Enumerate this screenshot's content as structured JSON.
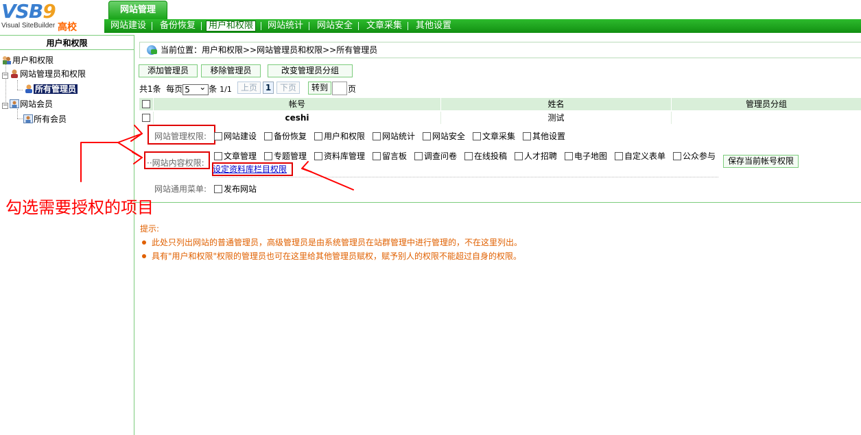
{
  "logo": {
    "text": "VSB",
    "suffix": "9",
    "subtitle": "Visual SiteBuilder",
    "badge": "高校"
  },
  "top_tab": "网站管理",
  "nav": [
    "网站建设",
    "备份恢复",
    "用户和权限",
    "网站统计",
    "网站安全",
    "文章采集",
    "其他设置"
  ],
  "left": {
    "title": "用户和权限",
    "tree": {
      "root": "用户和权限",
      "admins": "网站管理员和权限",
      "all_admins": "所有管理员",
      "members": "网站会员",
      "all_members": "所有会员"
    }
  },
  "breadcrumb": "当前位置：用户和权限>>网站管理员和权限>>所有管理员",
  "buttons": {
    "add": "添加管理员",
    "remove": "移除管理员",
    "change_group": "改变管理员分组",
    "save": "保存当前帐号权限"
  },
  "pager": {
    "total": "共1条",
    "per_page_label": "每页",
    "per_page": "5",
    "per_page_unit": "条",
    "page": "1/1",
    "prev": "上页",
    "current": "1",
    "next": "下页",
    "goto": "转到",
    "page_unit": "页"
  },
  "table": {
    "headers": [
      "帐号",
      "姓名",
      "管理员分组"
    ],
    "rows": [
      {
        "account": "ceshi",
        "name": "测试",
        "group": ""
      }
    ]
  },
  "permissions": {
    "site_admin_label": "网站管理权限:",
    "site_admin_items": [
      "网站建设",
      "备份恢复",
      "用户和权限",
      "网站统计",
      "网站安全",
      "文章采集",
      "其他设置"
    ],
    "content_label": "网站内容权限:",
    "content_items": [
      "文章管理",
      "专题管理",
      "资料库管理",
      "留言板",
      "调查问卷",
      "在线投稿",
      "人才招聘",
      "电子地图",
      "自定义表单",
      "公众参与"
    ],
    "column_link": "设定资料库栏目权限",
    "common_label": "网站通用菜单:",
    "common_items": [
      "发布网站"
    ]
  },
  "tips": {
    "title": "提示:",
    "items": [
      "此处只列出网站的普通管理员，高级管理员是由系统管理员在站群管理中进行管理的，不在这里列出。",
      "具有\"用户和权限\"权限的管理员也可在这里给其他管理员赋权，赋予别人的权限不能超过自身的权限。"
    ]
  },
  "annotation": "勾选需要授权的项目",
  "colors": {
    "nav_green": "#19a519",
    "annotation_red": "#e00000",
    "tips_orange": "#e06000"
  }
}
